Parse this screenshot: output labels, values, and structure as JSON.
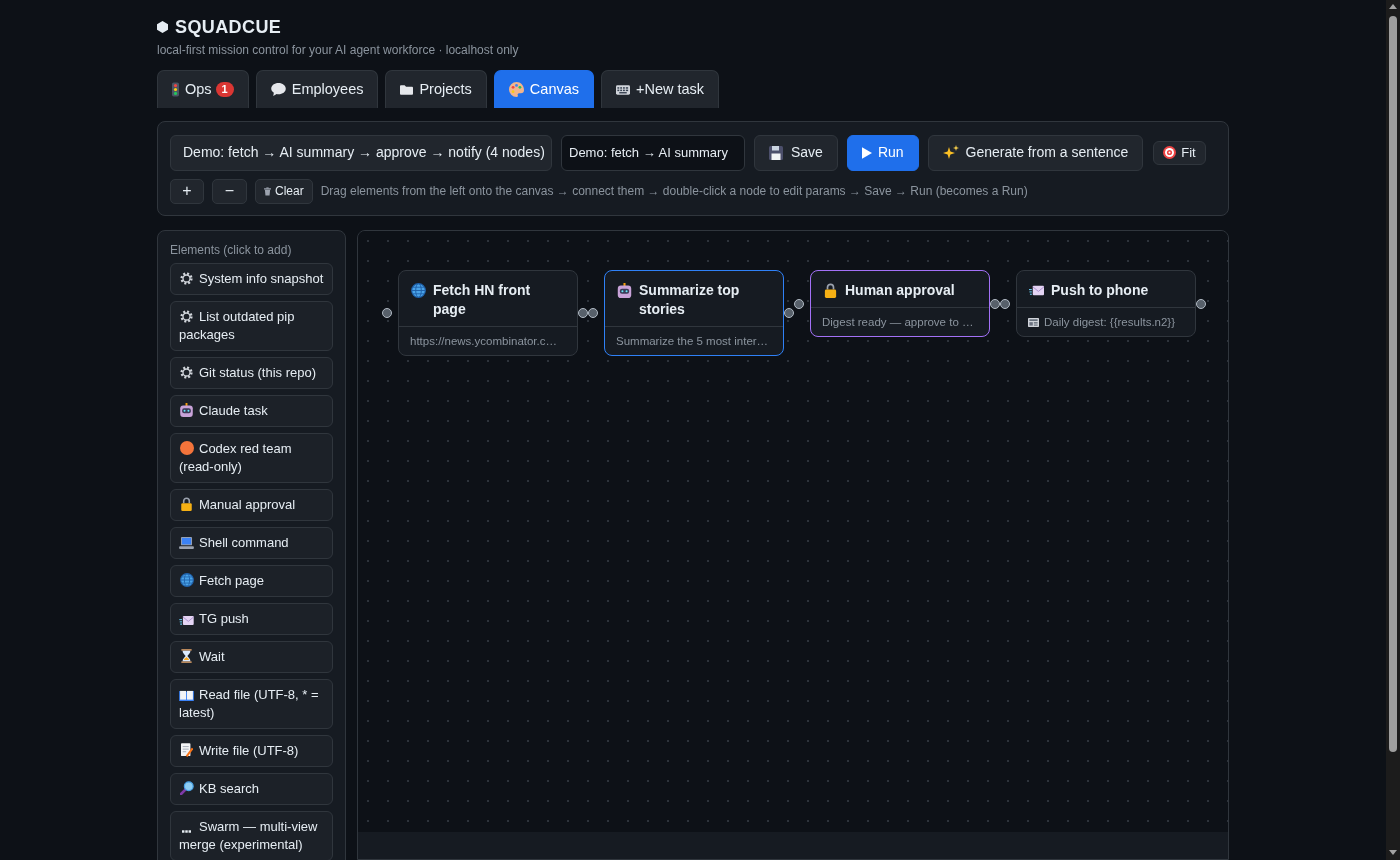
{
  "header": {
    "title": "SQUADCUE",
    "subtitle": "local-first mission control for your AI agent workforce · localhost only"
  },
  "tabs": [
    {
      "label": "Ops",
      "badge": "1",
      "selected": false
    },
    {
      "label": "Employees",
      "selected": false
    },
    {
      "label": "Projects",
      "selected": false
    },
    {
      "label": "Canvas",
      "selected": true
    },
    {
      "label": "+New task",
      "selected": false
    }
  ],
  "toolbar": {
    "template_select": "Demo: fetch → AI summary → approve → notify (4 nodes)",
    "name_field": "Demo: fetch → AI summary",
    "buttons": [
      {
        "kind": "save",
        "label": "Save"
      },
      {
        "kind": "run",
        "label": "Run"
      },
      {
        "kind": "generate",
        "label": "Generate from a sentence"
      },
      {
        "kind": "fit",
        "label": "Fit"
      }
    ],
    "zoom_in": "+",
    "zoom_out": "−",
    "clear": "Clear",
    "hint": "Drag elements from the left onto the canvas → connect them → double-click a node to edit params → Save → Run (becomes a Run)"
  },
  "elements": {
    "title": "Elements (click to add)",
    "items": [
      {
        "kind": "system",
        "label": "System info snapshot"
      },
      {
        "kind": "system",
        "label": "List outdated pip packages"
      },
      {
        "kind": "system",
        "label": "Git status (this repo)"
      },
      {
        "kind": "claude",
        "label": "Claude task"
      },
      {
        "kind": "codex",
        "label": "Codex red team (read-only)"
      },
      {
        "kind": "approval",
        "label": "Manual approval"
      },
      {
        "kind": "shell",
        "label": "Shell command"
      },
      {
        "kind": "fetch",
        "label": "Fetch page"
      },
      {
        "kind": "push",
        "label": "TG push"
      },
      {
        "kind": "wait",
        "label": "Wait"
      },
      {
        "kind": "read",
        "label": "Read file (UTF-8, * = latest)"
      },
      {
        "kind": "write",
        "label": "Write file (UTF-8)"
      },
      {
        "kind": "search",
        "label": "KB search"
      },
      {
        "kind": "swarm",
        "label": "Swarm — multi-view merge (experimental)"
      }
    ]
  },
  "canvas": {
    "nodes": [
      {
        "kind": "fetch",
        "title": "Fetch HN front page",
        "description": "https://news.ycombinator.c…",
        "selected": false
      },
      {
        "kind": "claude",
        "title": "Summarize top stories",
        "description": "Summarize the 5 most inter…",
        "selected": true
      },
      {
        "kind": "approval",
        "title": "Human approval",
        "description": "Digest ready — approve to …",
        "selected": false
      },
      {
        "kind": "push",
        "title": "Push to phone",
        "description": "Daily digest: {{results.n2}}",
        "selected": false
      }
    ]
  }
}
